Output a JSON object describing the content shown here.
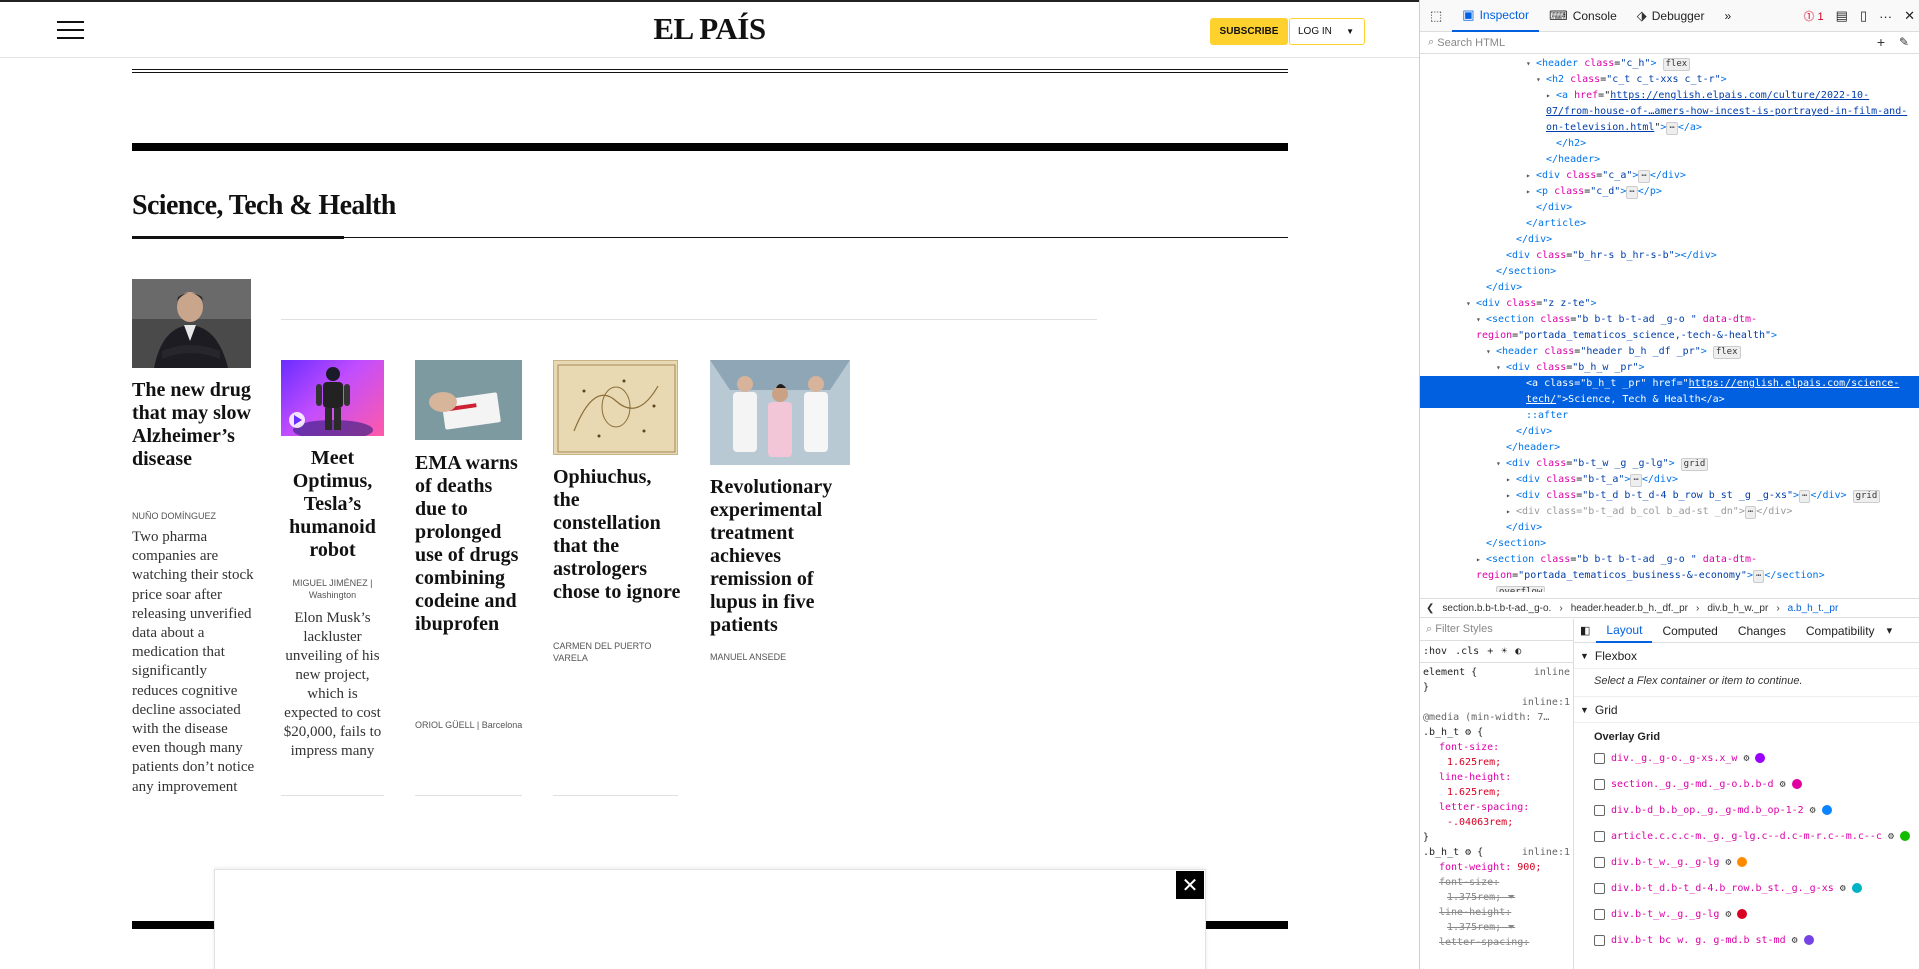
{
  "site": {
    "logo": "EL PAÍS",
    "subscribe_label": "SUBSCRIBE",
    "login_label": "LOG IN",
    "section_title": "Science, Tech & Health",
    "lead": {
      "title": "The new drug that may slow Alzheimer’s disease",
      "author": "NUÑO DOMÍNGUEZ",
      "summary": "Two pharma companies are watching their stock price soar after releasing unverified data about a medication that significantly reduces cognitive decline associated with the disease even though many patients don’t notice any improvement"
    },
    "articles": [
      {
        "title": "Meet Optimus, Tesla’s humanoid robot",
        "author": "MIGUEL JIMÉNEZ",
        "location": "Washington",
        "summary": "Elon Musk’s lackluster unveiling of his new project, which is expected to cost $20,000, fails to impress many"
      },
      {
        "title": "EMA warns of deaths due to prolonged use of drugs combining codeine and ibuprofen",
        "author": "ORIOL GÜELL",
        "location": "Barcelona"
      },
      {
        "title": "Ophiuchus, the constellation that the astrologers chose to ignore",
        "author": "CARMEN DEL PUERTO VARELA"
      },
      {
        "title": "Revolutionary experimental treatment achieves remission of lupus in five patients",
        "author": "MANUEL ANSEDE"
      }
    ],
    "ad_close": "✕"
  },
  "devtools": {
    "tabs": [
      "Inspector",
      "Console",
      "Debugger"
    ],
    "error_count": "1",
    "search_placeholder": "Search HTML",
    "tree_lines": {
      "l1_tag": "<header",
      "l1_attr": "class",
      "l1_val": "\"c_h\"",
      "l1_badge": "flex",
      "l2_tag": "<h2",
      "l2_attr": "class",
      "l2_val": "\"c_t c_t-xxs c_t-r\"",
      "l3_tag": "<a",
      "l3_attr": "href",
      "l3_val": "https://english.elpais.com/culture/2022-10-07/from-house-of-…amers-how-incest-is-portrayed-in-film-and-on-television.html",
      "l4": "</h2>",
      "l5": "</header>",
      "l6_tag": "<div",
      "l6_attr": "class",
      "l6_val": "\"c_a\"",
      "l7_tag": "<p",
      "l7_attr": "class",
      "l7_val": "\"c_d\"",
      "l8": "</div>",
      "l9": "</article>",
      "l10": "</div>",
      "l11_tag": "<div",
      "l11_attr": "class",
      "l11_val": "\"b_hr-s b_hr-s-b\"",
      "l12": "</section>",
      "l13": "</div>",
      "l14_tag": "<div",
      "l14_attr": "class",
      "l14_val": "\"z z-te\"",
      "l15_tag": "<section",
      "l15_attr": "class",
      "l15_val": "\"b b-t b-t-ad _g-o \"",
      "l15_attr2": "data-dtm-region",
      "l15_val2": "\"portada_tematicos_science,-tech-&-health\"",
      "l16_tag": "<header",
      "l16_attr": "class",
      "l16_val": "\"header b_h _df _pr\"",
      "l16_badge": "flex",
      "l17_tag": "<div",
      "l17_attr": "class",
      "l17_val": "\"b_h_w _pr\"",
      "l18_tag": "<a",
      "l18_attr": "class",
      "l18_val": "\"b_h_t _pr\"",
      "l18_attr2": "href",
      "l18_val2": "https://english.elpais.com/science-tech/",
      "l18_text": "Science, Tech & Health",
      "l19": "::after",
      "l20": "</div>",
      "l21": "</header>",
      "l22_tag": "<div",
      "l22_attr": "class",
      "l22_val": "\"b-t_w _g _g-lg\"",
      "l22_badge": "grid",
      "l23_tag": "<div",
      "l23_attr": "class",
      "l23_val": "\"b-t_a\"",
      "l24_tag": "<div",
      "l24_attr": "class",
      "l24_val": "\"b-t_d b-t_d-4 b_row b_st _g _g-xs\"",
      "l24_badge": "grid",
      "l25_tag": "<div",
      "l25_attr": "class",
      "l25_val": "\"b-t_ad b_col b_ad-st _dn\"",
      "l26": "</div>",
      "l27": "</section>",
      "l28_tag": "<section",
      "l28_attr": "class",
      "l28_val": "\"b b-t b-t-ad _g-o \"",
      "l28_attr2": "data-dtm-region",
      "l28_val2": "\"portada_tematicos_business-&-economy\"",
      "l28_close": "</section>",
      "l29_badge": "overflow"
    },
    "breadcrumbs": [
      "section.b.b-t.b-t-ad._g-o.",
      "header.header.b_h._df._pr",
      "div.b_h_w._pr",
      "a.b_h_t._pr"
    ],
    "filter_placeholder": "Filter Styles",
    "pseudo_hov": ":hov",
    "pseudo_cls": ".cls",
    "rules": {
      "element": "element {",
      "element_src": "inline",
      "close": "}",
      "src1": "inline:1",
      "media": "@media (min-width: 7…",
      "sel1": ".b_h_t",
      "p_fs": "font-size:",
      "v_fs": "1.625rem;",
      "p_lh": "line-height:",
      "v_lh": "1.625rem;",
      "p_ls": "letter-spacing:",
      "v_ls": "-.04063rem;",
      "src2": "inline:1",
      "sel2": ".b_h_t",
      "p_fw": "font-weight:",
      "v_fw": "900;",
      "s_fs": "font-size:",
      "s_fsv": "1.375rem;",
      "s_lh": "line-height:",
      "s_lhv": "1.375rem;",
      "s_ls": "letter-spacing:"
    },
    "layout_tabs": [
      "Layout",
      "Computed",
      "Changes",
      "Compatibility"
    ],
    "flexbox_label": "Flexbox",
    "flexbox_msg": "Select a Flex container or item to continue.",
    "grid_label": "Grid",
    "overlay_label": "Overlay Grid",
    "grid_items": [
      {
        "name": "div._g._g-o._g-xs.x_w",
        "color": "#9b00ff"
      },
      {
        "name": "section._g._g-md._g-o.b.b-d",
        "color": "#e000a0"
      },
      {
        "name": "div.b-d_b.b_op._g._g-md.b_op-1-2",
        "color": "#0a84ff"
      },
      {
        "name": "article.c.c.c-m._g._g-lg.c--d.c-m-r.c--m.c--c",
        "color": "#12bc00"
      },
      {
        "name": "div.b-t_w._g._g-lg",
        "color": "#ff8a00"
      },
      {
        "name": "div.b-t_d.b-t_d-4.b_row.b_st._g._g-xs",
        "color": "#00b3c4"
      },
      {
        "name": "div.b-t_w._g._g-lg",
        "color": "#d70022"
      },
      {
        "name": "div.b-t bc w. g. g-md.b st-md",
        "color": "#7542e5"
      }
    ]
  }
}
